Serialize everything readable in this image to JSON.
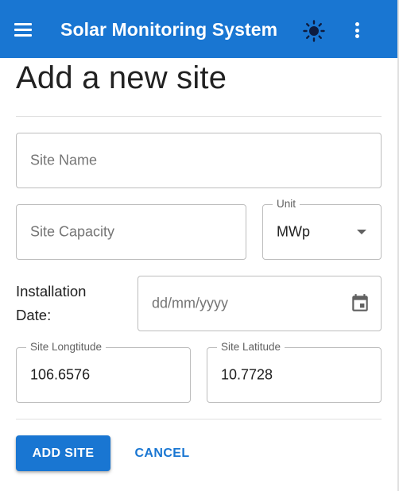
{
  "appbar": {
    "title": "Solar Monitoring System",
    "menu_icon": "hamburger-menu-icon",
    "theme_icon": "sun-icon",
    "more_icon": "more-vertical-icon",
    "background_color": "#1976d2"
  },
  "page": {
    "title": "Add a new site"
  },
  "form": {
    "site_name": {
      "placeholder": "Site Name",
      "value": ""
    },
    "site_capacity": {
      "placeholder": "Site Capacity",
      "value": ""
    },
    "unit": {
      "label": "Unit",
      "selected": "MWp"
    },
    "installation_date": {
      "label_line1": "Installation",
      "label_line2": "Date:",
      "placeholder": "dd/mm/yyyy",
      "icon": "calendar-icon"
    },
    "site_longitude": {
      "label": "Site Longtitude",
      "value": "106.6576"
    },
    "site_latitude": {
      "label": "Site Latitude",
      "value": "10.7728"
    }
  },
  "actions": {
    "add_label": "ADD SITE",
    "cancel_label": "CANCEL"
  }
}
